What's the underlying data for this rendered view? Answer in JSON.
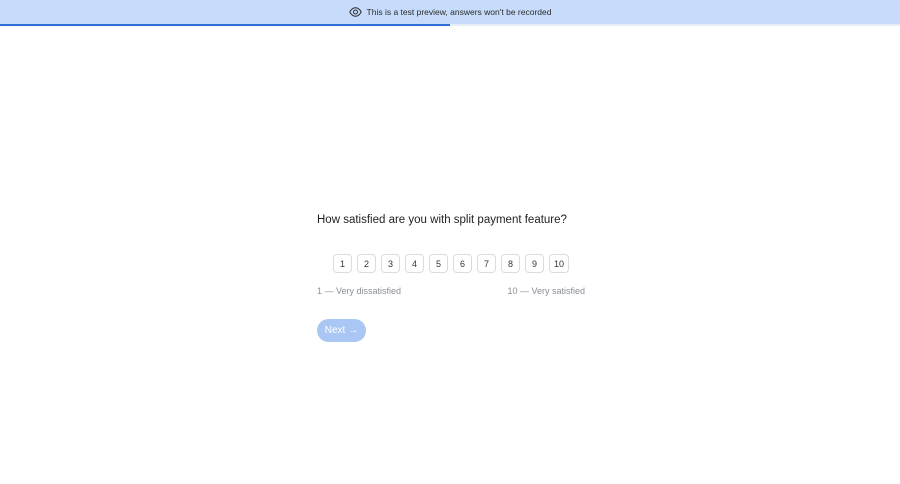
{
  "banner": {
    "icon": "eye-icon",
    "text": "This is a test preview, answers won't be recorded",
    "background": "#c7dcfa"
  },
  "progress": {
    "fraction": 0.5,
    "color": "#2f6fd6"
  },
  "question": {
    "text": "How satisfied are you with split payment feature?",
    "scale": [
      "1",
      "2",
      "3",
      "4",
      "5",
      "6",
      "7",
      "8",
      "9",
      "10"
    ],
    "min_label": "1 — Very dissatisfied",
    "max_label": "10 — Very satisfied"
  },
  "next_button": {
    "label": "Next",
    "icon": "arrow-right-icon",
    "color": "#a9c6f5"
  }
}
